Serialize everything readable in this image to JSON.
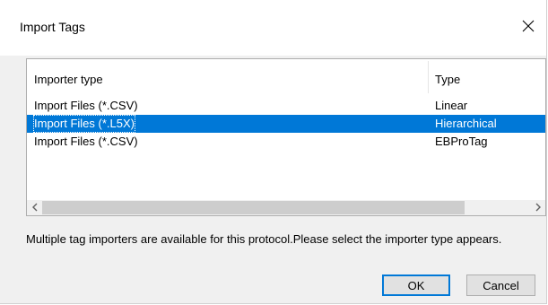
{
  "dialog": {
    "title": "Import Tags",
    "close_icon": "close-icon"
  },
  "list": {
    "columns": [
      "Importer type",
      "Type"
    ],
    "rows": [
      {
        "importer": "Import Files (*.CSV)",
        "type": "Linear",
        "selected": false
      },
      {
        "importer": "Import Files (*.L5X)",
        "type": "Hierarchical",
        "selected": true
      },
      {
        "importer": "Import Files (*.CSV)",
        "type": "EBProTag",
        "selected": false
      }
    ],
    "scroll_left_icon": "chevron-left-icon",
    "scroll_right_icon": "chevron-right-icon"
  },
  "message": "Multiple tag importers are available for this protocol.Please select the importer type appears.",
  "buttons": {
    "ok_label": "OK",
    "cancel_label": "Cancel"
  },
  "colors": {
    "selection": "#0078d7",
    "dialog_bg": "#f0f0f0"
  }
}
